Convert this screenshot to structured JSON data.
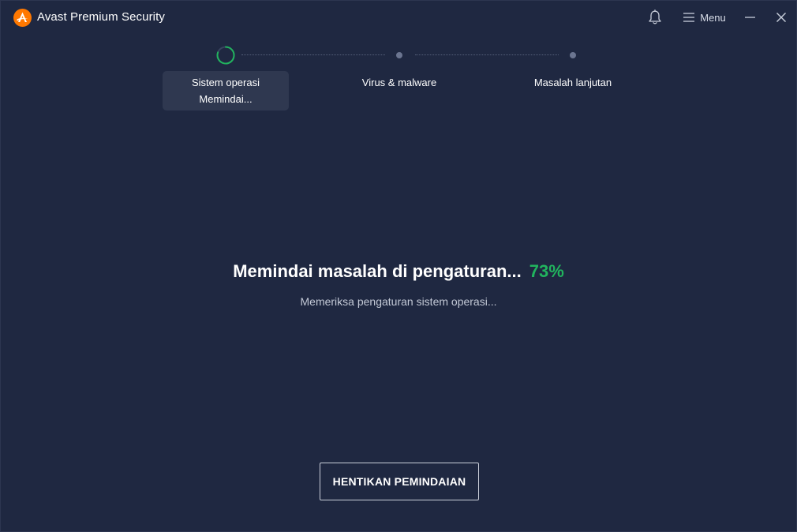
{
  "window": {
    "title": "Avast Premium Security",
    "menu_label": "Menu"
  },
  "icons": {
    "logo": "avast-logo-icon",
    "notifications": "bell-icon",
    "menu": "hamburger-icon",
    "minimize": "minimize-icon",
    "close": "close-icon",
    "active_step": "spinner-icon"
  },
  "stepper": {
    "steps": [
      {
        "title": "Sistem operasi",
        "status": "Memindai...",
        "state": "active"
      },
      {
        "title": "Virus & malware",
        "status": "",
        "state": "pending"
      },
      {
        "title": "Masalah lanjutan",
        "status": "",
        "state": "pending"
      }
    ]
  },
  "scan": {
    "heading": "Memindai masalah di pengaturan...",
    "percent": "73%",
    "progress": 0.73,
    "detail": "Memeriksa pengaturan sistem operasi..."
  },
  "actions": {
    "stop_label": "HENTIKAN PEMINDAIAN"
  },
  "colors": {
    "background": "#1f2841",
    "accent_green": "#21b45e",
    "brand_orange": "#ff7800",
    "active_step_bg": "#2f3850"
  }
}
